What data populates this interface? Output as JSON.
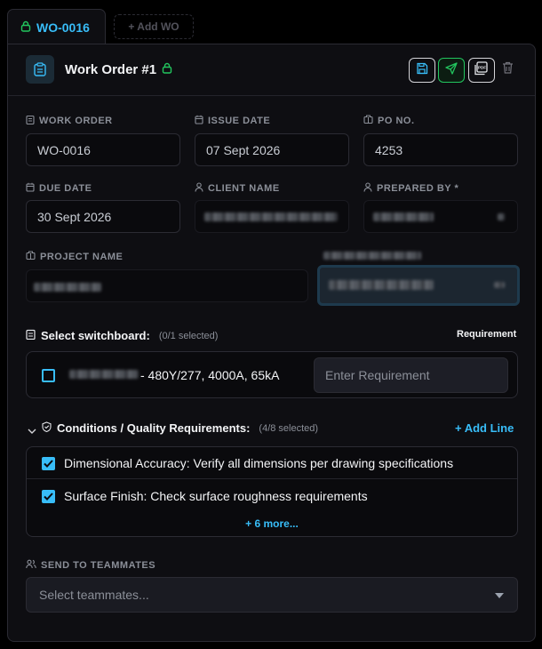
{
  "tabs": {
    "active": "WO-0016",
    "add_label": "+ Add WO"
  },
  "header": {
    "title": "Work Order #1"
  },
  "fields": {
    "work_order": {
      "label": "WORK ORDER",
      "value": "WO-0016"
    },
    "issue_date": {
      "label": "ISSUE DATE",
      "value": "07 Sept 2026"
    },
    "po_no": {
      "label": "PO NO.",
      "value": "4253"
    },
    "due_date": {
      "label": "DUE DATE",
      "value": "30 Sept 2026"
    },
    "client_name": {
      "label": "CLIENT NAME",
      "value": ""
    },
    "prepared_by": {
      "label": "PREPARED BY *",
      "value": ""
    },
    "project_name": {
      "label": "PROJECT NAME",
      "value": ""
    }
  },
  "switchboard": {
    "title": "Select switchboard:",
    "count": "(0/1 selected)",
    "requirement_header": "Requirement",
    "item_suffix": "- 480Y/277, 4000A, 65kA",
    "requirement_placeholder": "Enter Requirement"
  },
  "conditions": {
    "title": "Conditions / Quality Requirements:",
    "count": "(4/8 selected)",
    "add_line": "+ Add Line",
    "items": [
      {
        "text": "Dimensional Accuracy: Verify all dimensions per drawing specifications",
        "checked": true
      },
      {
        "text": "Surface Finish: Check surface roughness requirements",
        "checked": true
      }
    ],
    "more": "+ 6 more..."
  },
  "teammates": {
    "label": "SEND TO TEAMMATES",
    "placeholder": "Select teammates..."
  },
  "colors": {
    "accent": "#38bdf8",
    "green": "#22c55e",
    "background": "#0e0e12"
  }
}
